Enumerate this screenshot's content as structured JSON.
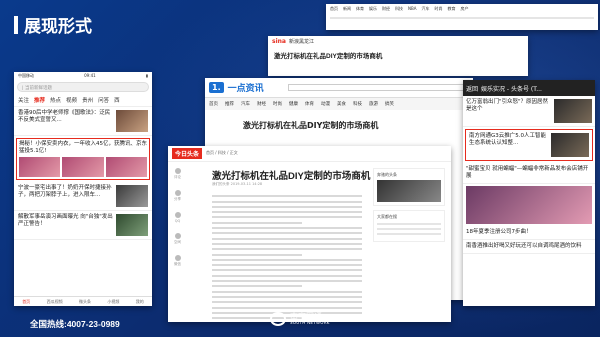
{
  "slide": {
    "title": "展现形式",
    "hotline": "全国热线:4007-23-0989"
  },
  "logo": {
    "cn": "南宇网通",
    "en": "SOUTH NETWORK"
  },
  "phone": {
    "status_left": "中国移动",
    "status_time": "09:41",
    "search": "| 当前新鲜话题",
    "tabs": [
      "关注",
      "推荐",
      "热点",
      "视频",
      "贵州",
      "问答",
      "西"
    ],
    "items": [
      {
        "text": "香港90后中学老师撑《国歌法》：泛民不反美式宣誓又..."
      },
      {
        "text": "揭秘！小保安卖内衣，一年收入45亿，获腾讯、京东猛投5.1亿!"
      },
      {
        "text": "宁波一豪宅出事了！奶奶开保时捷接孙子，两把刀架脖子上，进入限车..."
      },
      {
        "text": "解散军事岳演习画面曝光 向\"台独\"发出严正警告！"
      }
    ],
    "bottom": [
      "首页",
      "西瓜视频",
      "微头条",
      "小视频",
      "我的"
    ]
  },
  "back1": {
    "nav": [
      "首页",
      "新闻",
      "体育",
      "娱乐",
      "财经",
      "科技",
      "NBA",
      "汽车",
      "时尚",
      "教育",
      "房产"
    ]
  },
  "back2": {
    "site": "新浪黑龙江",
    "title": "激光打标机在礼品DIY定制的市场商机"
  },
  "yidian": {
    "logo_icon": "1.",
    "logo_name": "一点资讯",
    "nav": [
      "首页",
      "推荐",
      "汽车",
      "财经",
      "时尚",
      "健康",
      "体育",
      "动漫",
      "美食",
      "科技",
      "旅游",
      "搞笑"
    ],
    "title": "激光打标机在礼品DIY定制的市场商机"
  },
  "toutiao": {
    "logo": "今日头条",
    "breadcrumb": "首页 / 科技 / 正文",
    "title": "激光打标机在礼品DIY定制的市场商机",
    "meta": "我们的头条 2019-03-11 14:28",
    "side": [
      "评论",
      "分享",
      "QQ",
      "空间",
      "微信"
    ],
    "card1_title": "奔驰的头条",
    "card2_title": "大家都在搜"
  },
  "mobile2": {
    "back": "返回",
    "head": "娱乐实况 - 头条号 (T...",
    "items": [
      {
        "text": "亿万富翁出门\"引众怒\"？原因居然是这个"
      },
      {
        "text": "南方网通G3云推广5.0人工智能生态系统认认知整..."
      },
      {
        "text": "\"甜蜜宝贝 就用蝙蝠\"—蝙蝠非常新品发布会店铺开展"
      },
      {
        "text": "18年夏季注册公司7步曲！"
      },
      {
        "text": "南香酒推出好喝又好玩还可以自调鸡尾酒的饮料"
      }
    ]
  }
}
